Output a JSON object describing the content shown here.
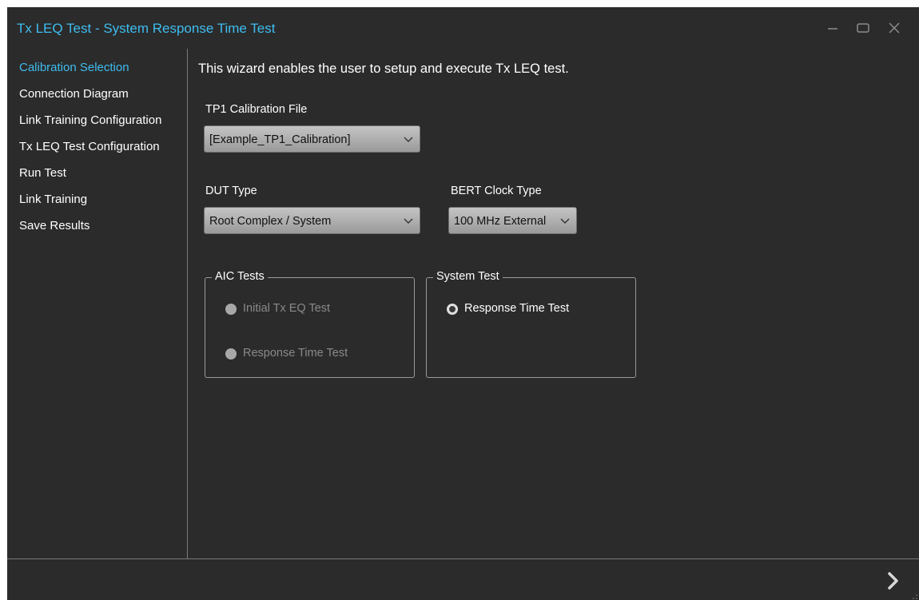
{
  "window": {
    "title": "Tx LEQ Test - System Response Time Test",
    "controls": {
      "minimize_icon": "minimize-icon",
      "maximize_icon": "maximize-icon",
      "close_icon": "close-icon"
    }
  },
  "sidebar": {
    "items": [
      {
        "label": "Calibration Selection",
        "active": true
      },
      {
        "label": "Connection Diagram"
      },
      {
        "label": "Link Training Configuration"
      },
      {
        "label": "Tx LEQ Test Configuration"
      },
      {
        "label": "Run Test"
      },
      {
        "label": "Link Training"
      },
      {
        "label": "Save Results"
      }
    ]
  },
  "main": {
    "intro": "This wizard enables the user to setup and execute Tx LEQ test.",
    "tp1_calibration": {
      "label": "TP1 Calibration File",
      "value": "[Example_TP1_Calibration]"
    },
    "dut_type": {
      "label": "DUT Type",
      "value": "Root Complex / System"
    },
    "bert_clock": {
      "label": "BERT Clock Type",
      "value": "100 MHz External"
    },
    "aic_tests": {
      "title": "AIC Tests",
      "options": [
        {
          "label": "Initial Tx EQ Test",
          "enabled": false
        },
        {
          "label": "Response Time Test",
          "enabled": false
        }
      ]
    },
    "system_test": {
      "title": "System Test",
      "options": [
        {
          "label": "Response Time Test",
          "enabled": true
        }
      ]
    }
  },
  "footer": {
    "next_icon": "chevron-right-icon"
  },
  "colors": {
    "accent": "#3ebdf0",
    "background": "#2b2b2b",
    "text": "#e8e8e8"
  }
}
